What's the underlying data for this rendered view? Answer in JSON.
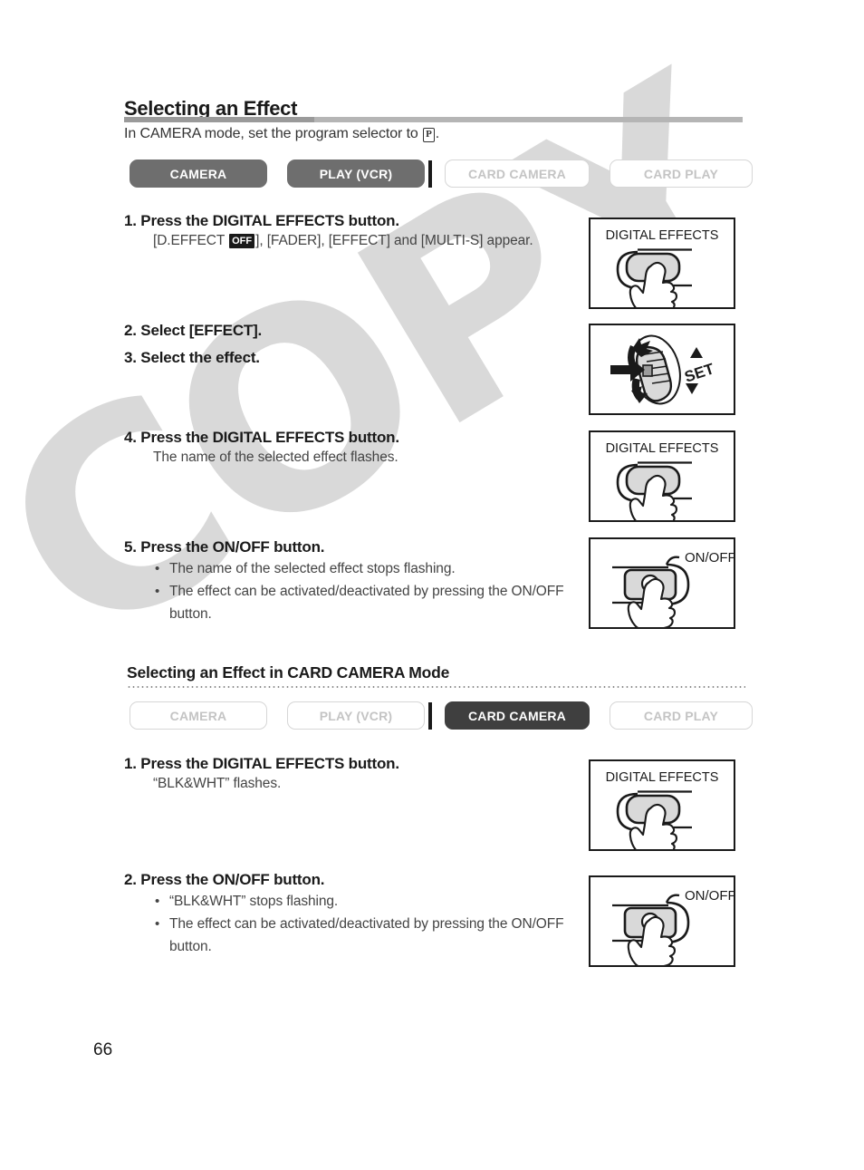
{
  "page": {
    "number": "66",
    "watermark": "COPY"
  },
  "header": {
    "title": "Selecting an Effect",
    "intro_before": "In CAMERA mode, set the program selector to ",
    "intro_badge": "P",
    "intro_after": "."
  },
  "mode_bar_top": {
    "buttons": [
      {
        "label": "CAMERA",
        "state": "active"
      },
      {
        "label": "PLAY (VCR)",
        "state": "active"
      },
      {
        "label": "CARD CAMERA",
        "state": "inactive"
      },
      {
        "label": "CARD PLAY",
        "state": "inactive"
      }
    ]
  },
  "steps_main": [
    {
      "title": "1. Press the DIGITAL EFFECTS button.",
      "sub_before": "[D.EFFECT ",
      "sub_badge": "OFF",
      "sub_after": "], [FADER], [EFFECT] and [MULTI-S] appear."
    },
    {
      "title": "2. Select [EFFECT]."
    },
    {
      "title": "3. Select the effect."
    },
    {
      "title": "4. Press the DIGITAL EFFECTS button.",
      "sub": "The name of the selected effect flashes."
    },
    {
      "title": "5. Press the ON/OFF button.",
      "bullets": [
        "The name of the selected effect stops flashing.",
        "The effect can be activated/deactivated by pressing the ON/OFF button."
      ]
    }
  ],
  "section2": {
    "title": "Selecting an Effect in CARD CAMERA Mode",
    "mode_bar": {
      "buttons": [
        {
          "label": "CAMERA",
          "state": "inactive"
        },
        {
          "label": "PLAY (VCR)",
          "state": "inactive"
        },
        {
          "label": "CARD CAMERA",
          "state": "active-dark"
        },
        {
          "label": "CARD PLAY",
          "state": "inactive"
        }
      ]
    },
    "steps": [
      {
        "title": "1. Press the DIGITAL EFFECTS button.",
        "sub": "“BLK&WHT” flashes."
      },
      {
        "title": "2. Press the ON/OFF button.",
        "bullets": [
          "“BLK&WHT” stops flashing.",
          "The effect can be activated/deactivated by pressing the ON/OFF button."
        ]
      }
    ]
  },
  "illustrations": [
    {
      "id": "digital-effects-1",
      "caption": "DIGITAL EFFECTS",
      "kind": "button-press"
    },
    {
      "id": "set-dial",
      "caption": "SET",
      "kind": "dial"
    },
    {
      "id": "digital-effects-2",
      "caption": "DIGITAL EFFECTS",
      "kind": "button-press"
    },
    {
      "id": "on-off-1",
      "caption": "ON/OFF",
      "kind": "round-button-press"
    },
    {
      "id": "digital-effects-3",
      "caption": "DIGITAL EFFECTS",
      "kind": "button-press"
    },
    {
      "id": "on-off-2",
      "caption": "ON/OFF",
      "kind": "round-button-press"
    }
  ]
}
